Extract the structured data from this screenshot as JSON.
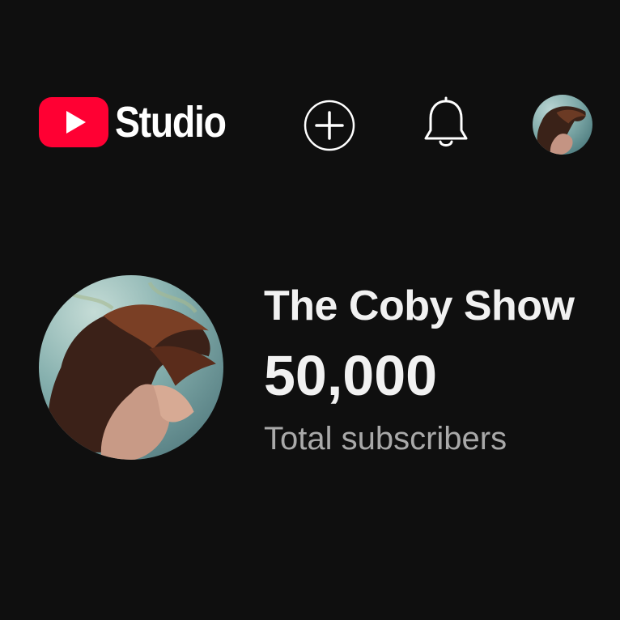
{
  "header": {
    "logo_text": "Studio",
    "logo_play_color": "#ff0033",
    "icons": {
      "create": "add-circle-icon",
      "notifications": "bell-icon",
      "account": "avatar"
    }
  },
  "channel": {
    "name": "The Coby Show",
    "subscriber_count": "50,000",
    "subscriber_label": "Total subscribers"
  },
  "colors": {
    "background": "#0f0f0f",
    "primary_text": "#f1f1f1",
    "secondary_text": "#a9a9a9"
  }
}
